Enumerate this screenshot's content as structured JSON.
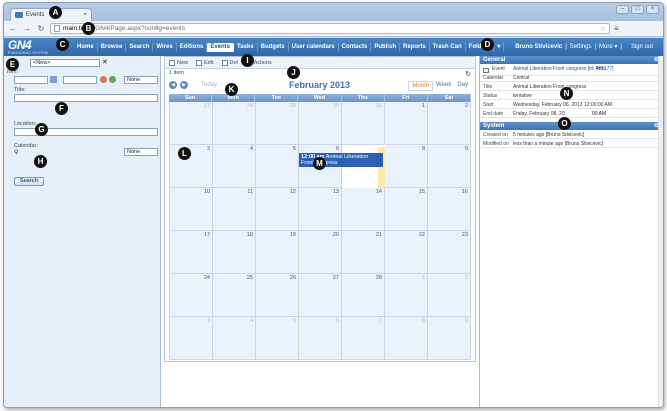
{
  "browser": {
    "tab_title": "Events",
    "url_host": "main.te",
    "url_path": "om/GN4/Page.aspx?config=events"
  },
  "app": {
    "logo": "GN4",
    "logo_sub": "PUBLISHING SYSTEM",
    "menu": [
      "Home",
      "Browse",
      "Search",
      "Wires",
      "Editions",
      "Events",
      "Tasks",
      "Budgets",
      "User calendars",
      "Contacts",
      "Publish",
      "Reports",
      "Trash Can",
      "Folders",
      "▾"
    ],
    "active_menu": "Events",
    "user": "Bruno Stivicevic",
    "settings": "Settings",
    "more": "More ▾",
    "signout": "Sign out"
  },
  "left": {
    "new_select": "<New>",
    "from_label": "rom:",
    "none1": "None",
    "title_label": "Title:",
    "location_label": "Location:",
    "calendar_label": "Calendar:",
    "none2": "None",
    "search_button": "Search"
  },
  "center": {
    "toolbar": {
      "new": "New",
      "edit": "Edit",
      "delete": "Del",
      "actions": "Actions"
    },
    "items": "1 item",
    "today": "Today",
    "month_title": "February 2013",
    "views": [
      "Month",
      "Week",
      "Day"
    ],
    "active_view": "Month",
    "dow": [
      "Sun",
      "Mon",
      "Tue",
      "Wed",
      "Thu",
      "Fri",
      "Sat"
    ],
    "weeks": [
      [
        {
          "d": "27",
          "o": true
        },
        {
          "d": "28",
          "o": true
        },
        {
          "d": "29",
          "o": true
        },
        {
          "d": "30",
          "o": true
        },
        {
          "d": "31",
          "o": true
        },
        {
          "d": "1"
        },
        {
          "d": "2"
        }
      ],
      [
        {
          "d": "3"
        },
        {
          "d": "4"
        },
        {
          "d": "5"
        },
        {
          "d": "6"
        },
        {
          "d": "7",
          "t": true
        },
        {
          "d": "8"
        },
        {
          "d": "9"
        }
      ],
      [
        {
          "d": "10"
        },
        {
          "d": "11"
        },
        {
          "d": "12"
        },
        {
          "d": "13"
        },
        {
          "d": "14"
        },
        {
          "d": "15"
        },
        {
          "d": "16"
        }
      ],
      [
        {
          "d": "17"
        },
        {
          "d": "18"
        },
        {
          "d": "19"
        },
        {
          "d": "20"
        },
        {
          "d": "21"
        },
        {
          "d": "22"
        },
        {
          "d": "23"
        }
      ],
      [
        {
          "d": "24"
        },
        {
          "d": "25"
        },
        {
          "d": "26"
        },
        {
          "d": "27"
        },
        {
          "d": "28"
        },
        {
          "d": "1",
          "o": true
        },
        {
          "d": "2",
          "o": true
        }
      ],
      [
        {
          "d": "3",
          "o": true
        },
        {
          "d": "4",
          "o": true
        },
        {
          "d": "5",
          "o": true
        },
        {
          "d": "6",
          "o": true
        },
        {
          "d": "7",
          "o": true
        },
        {
          "d": "8",
          "o": true
        },
        {
          "d": "9",
          "o": true
        }
      ]
    ],
    "event": {
      "time": "12:00 am",
      "title": "Animal Liberation Front congress"
    }
  },
  "right": {
    "general": "General",
    "rows": [
      {
        "k": "Event",
        "v": "Animal Liberation Front congress [id: 481177]"
      },
      {
        "k": "Calendar",
        "v": "Central"
      },
      {
        "k": "Title",
        "v": "Animal Liberation Front congress"
      },
      {
        "k": "Status",
        "v": "tentative"
      },
      {
        "k": "Start",
        "v": "Wednesday, February 06, 2013 12:00:00 AM"
      },
      {
        "k": "End date",
        "v": "Friday, February 08, 20"
      }
    ],
    "end_tail": "00 AM",
    "print": "Print",
    "system": "System",
    "sysrows": [
      {
        "k": "Created on",
        "v": "5 minutes ago [Bruno Stivicevic]"
      },
      {
        "k": "Modified on",
        "v": "less than a minute ago [Bruno Stivicevic]"
      }
    ]
  },
  "markers": [
    "A",
    "B",
    "C",
    "D",
    "E",
    "F",
    "G",
    "H",
    "I",
    "J",
    "K",
    "L",
    "M",
    "N",
    "O"
  ]
}
